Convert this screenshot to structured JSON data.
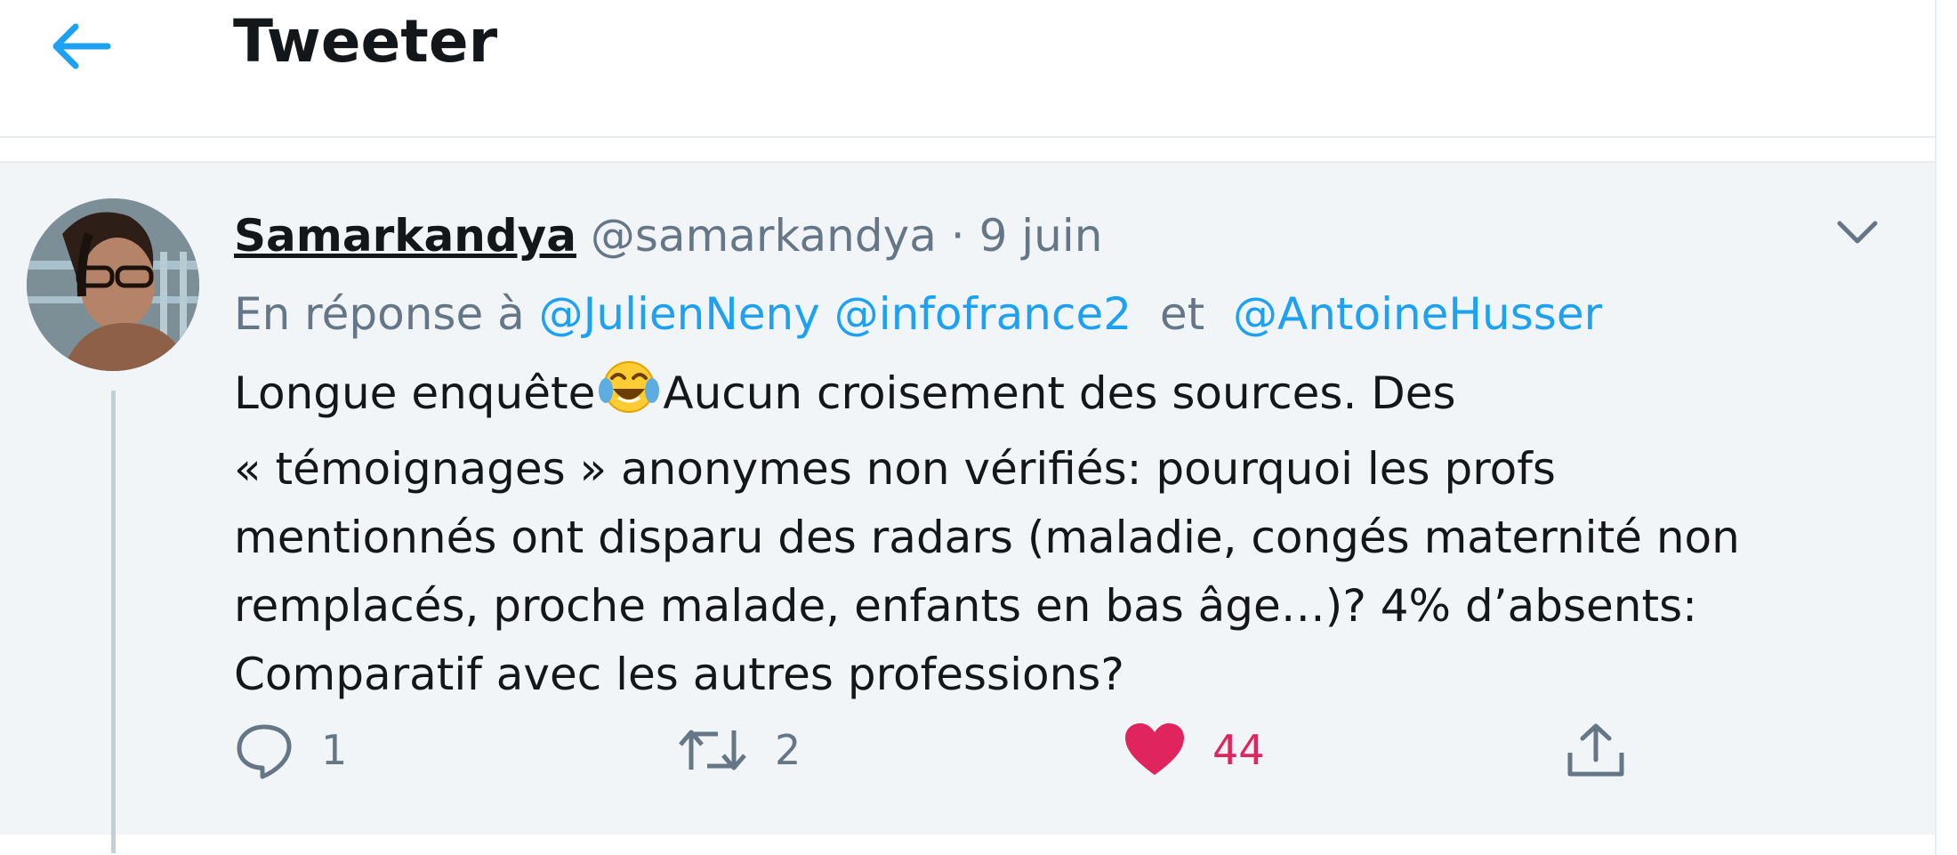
{
  "header": {
    "title": "Tweeter",
    "back_icon": "arrow-left-icon"
  },
  "tweet": {
    "display_name": "Samarkandya",
    "handle": "@samarkandya",
    "separator": "·",
    "date": "9 juin",
    "reply_prefix": "En réponse à",
    "mentions": [
      "@JulienNeny",
      "@infofrance2",
      "@AntoineHusser"
    ],
    "mention_joiner": "et",
    "text_part1": "Longue enquête",
    "emoji": "face-with-tears-of-joy",
    "text_part2": "Aucun croisement des sources. Des\n« témoignages » anonymes non vérifiés: pourquoi les profs\nmentionnés ont disparu des radars (maladie, congés maternité non\nremplacés, proche malade, enfants en bas âge…)? 4% d’absents:\nComparatif avec les autres professions?",
    "actions": {
      "reply_count": "1",
      "retweet_count": "2",
      "like_count": "44"
    }
  },
  "colors": {
    "accent": "#1da1f2",
    "like": "#e0245e",
    "muted": "#657786",
    "text": "#14171a",
    "tweet_bg": "#f2f5f8"
  }
}
